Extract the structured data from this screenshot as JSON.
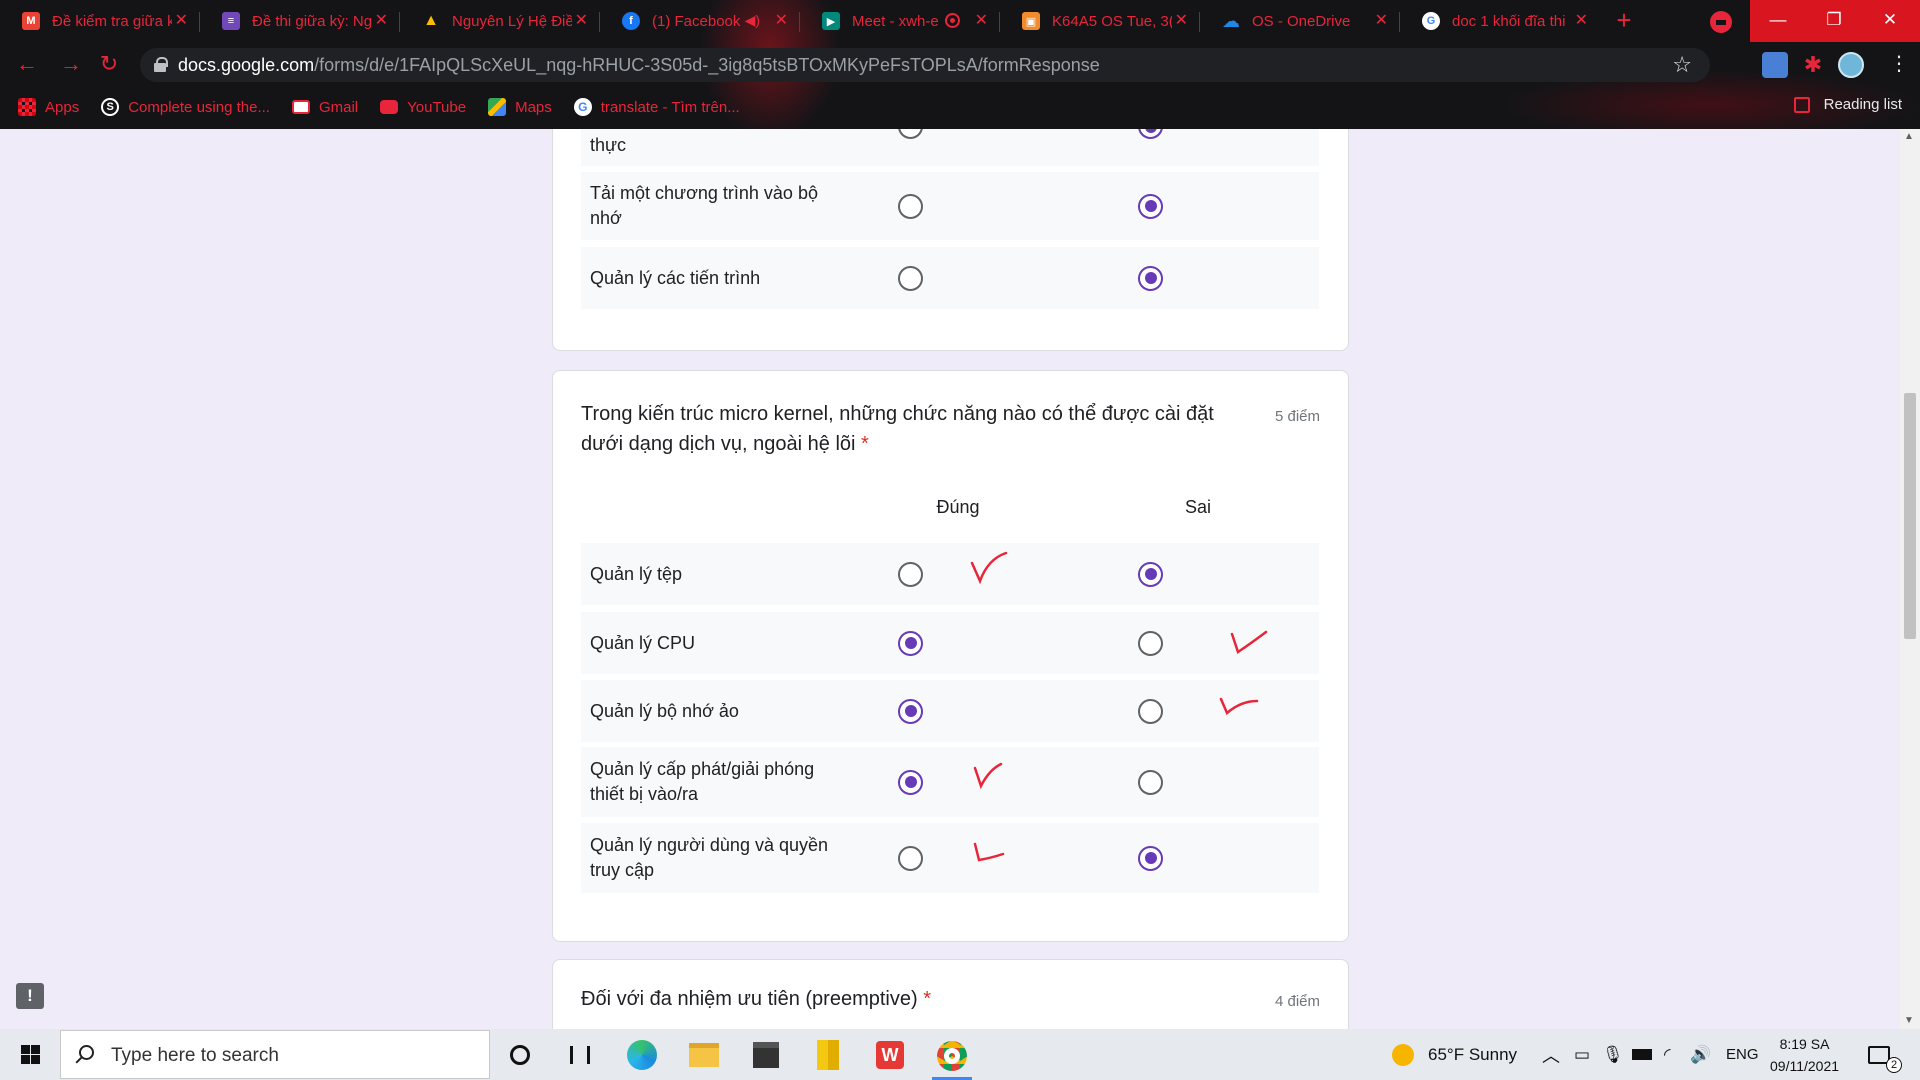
{
  "browser": {
    "tabs": [
      {
        "label": "Đề kiểm tra giữa k",
        "favicon_color": "#ea4335",
        "favicon_text": "M"
      },
      {
        "label": "Đề thi giữa kỳ: Ng",
        "favicon_color": "#7248b9",
        "favicon_text": "≡"
      },
      {
        "label": "Nguyên Lý Hệ Điề",
        "favicon_color": "#fbbc04",
        "favicon_text": "▲"
      },
      {
        "label": "(1) Facebook",
        "favicon_color": "#1877f2",
        "favicon_text": "f"
      },
      {
        "label": "Meet - xwh-e",
        "favicon_color": "#00897b",
        "favicon_text": "▶"
      },
      {
        "label": "K64A5 OS Tue, 3(",
        "favicon_color": "#f28b2c",
        "favicon_text": "▣"
      },
      {
        "label": "OS - OneDrive",
        "favicon_color": "#1e88e5",
        "favicon_text": "☁"
      },
      {
        "label": "doc 1 khối đĩa thi",
        "favicon_color": "#ffffff",
        "favicon_text": "G"
      }
    ],
    "url_host": "docs.google.com",
    "url_path": "/forms/d/e/1FAIpQLScXeUL_nqg-hRHUC-3S05d-_3ig8q5tsBTOxMKyPeFsTOPLsA/formResponse",
    "bookmarks": [
      "Apps",
      "Complete using the...",
      "Gmail",
      "YouTube",
      "Maps",
      "translate - Tìm trên..."
    ],
    "reading_list": "Reading list"
  },
  "form": {
    "prev_question": {
      "rows": [
        {
          "label": "thực",
          "answer": "false"
        },
        {
          "label": "Tải một chương trình vào bộ nhớ",
          "answer": "false"
        },
        {
          "label": "Quản lý các tiến trình",
          "answer": "false"
        }
      ]
    },
    "question": {
      "title": "Trong kiến trúc micro kernel, những chức năng nào có thể được cài đặt dưới dạng dịch vụ, ngoài hệ lõi",
      "required_mark": "*",
      "points": "5 điểm",
      "col_true": "Đúng",
      "col_false": "Sai",
      "rows": [
        {
          "label": "Quản lý tệp",
          "answer": "false",
          "annotation": "true"
        },
        {
          "label": "Quản lý CPU",
          "answer": "true",
          "annotation": "false"
        },
        {
          "label": "Quản lý bộ nhớ ảo",
          "answer": "true",
          "annotation": "false"
        },
        {
          "label": "Quản lý cấp phát/giải phóng thiết bị vào/ra",
          "answer": "true",
          "annotation": "true"
        },
        {
          "label": "Quản lý người dùng và quyền truy cập",
          "answer": "false",
          "annotation": "true"
        }
      ]
    },
    "next_question": {
      "title": "Đối với đa nhiệm ưu tiên (preemptive)",
      "required_mark": "*",
      "points": "4 điểm"
    }
  },
  "taskbar": {
    "search_placeholder": "Type here to search",
    "weather": "65°F  Sunny",
    "language": "ENG",
    "time": "8:19 SA",
    "date": "09/11/2021",
    "notification_count": "2"
  },
  "colors": {
    "accent_purple": "#673ab7",
    "chrome_red": "#e8253a",
    "annotation_red": "#e8253a"
  }
}
